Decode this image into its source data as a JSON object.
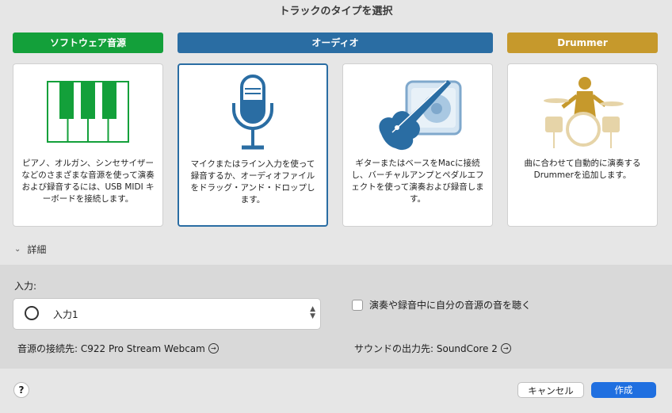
{
  "dialog": {
    "title": "トラックのタイプを選択"
  },
  "categories": [
    {
      "label": "ソフトウェア音源",
      "color": "#13a03a"
    },
    {
      "label": "オーディオ",
      "color": "#2a6da3"
    },
    {
      "label": "Drummer",
      "color": "#c6992c"
    }
  ],
  "cards": [
    {
      "desc": "ピアノ、オルガン、シンセサイザーなどのさまざまな音源を使って演奏および録音するには、USB MIDI キーボードを接続します。",
      "icon": "piano-keyboard-icon"
    },
    {
      "desc": "マイクまたはライン入力を使って録音するか、オーディオファイルをドラッグ・アンド・ドロップします。",
      "icon": "microphone-icon",
      "selected": true
    },
    {
      "desc": "ギターまたはベースをMacに接続し、バーチャルアンプとペダルエフェクトを使って演奏および録音します。",
      "icon": "guitar-amp-icon"
    },
    {
      "desc": "曲に合わせて自動的に演奏するDrummerを追加します。",
      "icon": "drummer-icon"
    }
  ],
  "details": {
    "label": "詳細"
  },
  "input": {
    "label": "入力:",
    "value": "入力1",
    "monitor_label": "演奏や録音中に自分の音源の音を聴く",
    "monitor_checked": false,
    "device_label": "音源の接続先: C922 Pro Stream Webcam",
    "output_label": "サウンドの出力先: SoundCore 2"
  },
  "footer": {
    "help": "?",
    "cancel": "キャンセル",
    "create": "作成"
  }
}
